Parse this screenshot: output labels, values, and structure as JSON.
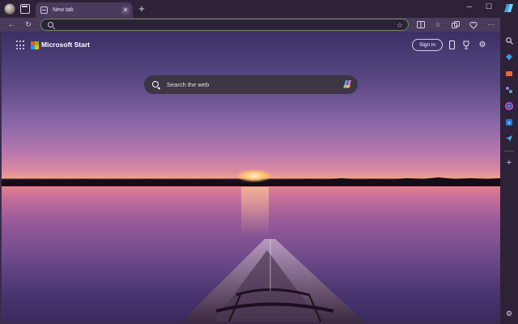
{
  "tab": {
    "title": "New tab",
    "close_glyph": "✕"
  },
  "window_controls": {
    "minimize": "─",
    "maximize": "☐",
    "close": "✕"
  },
  "toolbar": {
    "back_glyph": "←",
    "refresh_glyph": "↻",
    "address_value": "",
    "address_placeholder": "",
    "favorite_glyph": "☆",
    "icons": [
      "split-screen-icon",
      "favorites-icon",
      "collections-icon",
      "browser-essentials-icon",
      "more-icon"
    ]
  },
  "ntp": {
    "brand": "Microsoft Start",
    "sign_in_label": "Sign in",
    "search_placeholder": "Search the web",
    "top_icons": [
      "phone-icon",
      "rewards-icon",
      "settings-icon"
    ]
  },
  "sidebar": {
    "icons": [
      "search-icon",
      "shopping-icon",
      "tools-icon",
      "games-icon",
      "microsoft-365-icon",
      "outlook-icon",
      "drop-icon",
      "add-icon",
      "sidebar-settings-icon"
    ],
    "add_glyph": "+"
  },
  "colors": {
    "accent": "#6a8a5a",
    "chrome_dark": "#2e2238",
    "chrome_mid": "#4a3a5c"
  }
}
